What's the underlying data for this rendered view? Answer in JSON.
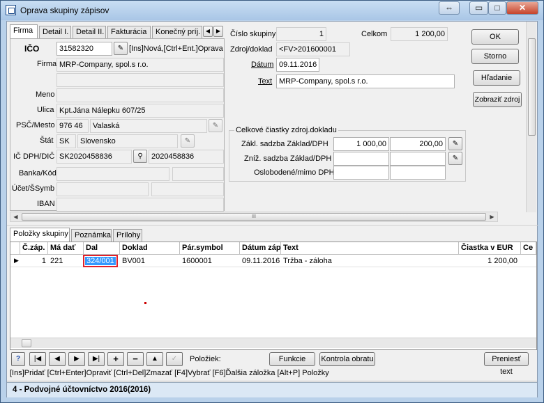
{
  "window": {
    "title": "Oprava skupiny zápisov",
    "controls": {
      "restore_glyph": "⇔",
      "minimize_glyph": "▭",
      "maximize_glyph": "□",
      "close_glyph": "✕"
    }
  },
  "top_tabs": [
    "Firma",
    "Detail I.",
    "Detail II.",
    "Fakturácia",
    "Konečný príj."
  ],
  "firm": {
    "ico_label": "IČO",
    "ico_value": "31582320",
    "ico_hint": "[Ins]Nová,[Ctrl+Ent.]Oprava",
    "firma_label": "Firma",
    "firma_value": "MRP-Company, spol.s r.o.",
    "meno_label": "Meno",
    "ulica_label": "Ulica",
    "ulica_value": "Kpt.Jána Nálepku 607/25",
    "psc_label": "PSČ/Mesto",
    "psc_value": "976 46",
    "mesto_value": "Valaská",
    "stat_label": "Štát",
    "stat_code": "SK",
    "stat_name": "Slovensko",
    "icdph_label": "IČ DPH/DIČ",
    "icdph_value": "SK2020458836",
    "dic_value": "2020458836",
    "banka_label": "Banka/Kód",
    "ucet_label": "Účet/ŠSymb",
    "iban_label": "IBAN"
  },
  "header": {
    "cislo_label": "Číslo skupiny",
    "cislo_value": "1",
    "celkom_label": "Celkom",
    "celkom_value": "1 200,00",
    "zdroj_label": "Zdroj/doklad",
    "zdroj_value": "<FV>201600001",
    "datum_label": "Dátum",
    "datum_value": "09.11.2016",
    "text_label": "Text",
    "text_value": "MRP-Company, spol.s r.o."
  },
  "totals": {
    "group_title": "Celkové čiastky zdroj.dokladu",
    "row1_label": "Zákl. sadzba Základ/DPH",
    "row1_base": "1 000,00",
    "row1_vat": "200,00",
    "row2_label": "Zníž. sadzba Základ/DPH",
    "row3_label": "Oslobodené/mimo DPH"
  },
  "buttons": {
    "ok": "OK",
    "storno": "Storno",
    "hladanie": "Hľadanie",
    "zobrazit": "Zobraziť zdroj",
    "funkcie": "Funkcie",
    "kontrola": "Kontrola obratu",
    "preniest": "Preniesť text"
  },
  "bottom_tabs": [
    "Položky skupiny",
    "Poznámka",
    "Prílohy"
  ],
  "grid": {
    "columns": [
      "Č.záp.",
      "Má dať",
      "Dal",
      "Doklad",
      "Pár.symbol",
      "Dátum záp",
      "Text",
      "Čiastka v EUR",
      "Ce"
    ],
    "rows": [
      {
        "cislo": "1",
        "ma_dat": "221",
        "dal": "324/001",
        "doklad": "BV001",
        "par_symbol": "1600001",
        "datum": "09.11.2016",
        "text": "Tržba - záloha",
        "ciastka": "1 200,00"
      }
    ]
  },
  "nav": {
    "help": "?",
    "first": "|◀",
    "prev": "◀",
    "next": "▶",
    "last": "▶|",
    "add": "+",
    "remove": "−",
    "up": "▲",
    "check": "✓",
    "polozkiek_label": "Položiek:"
  },
  "status_hint": "[Ins]Pridať [Ctrl+Enter]Opraviť [Ctrl+Del]Zmazať [F4]Vybrať [F6]Ďalšia záložka [Alt+P] Položky",
  "status_bar": "4 - Podvojné účtovníctvo 2016(2016)",
  "scroll": {
    "hscroll_grip": "III"
  },
  "colors": {
    "selection": "#3399ff",
    "highlight_border": "#e0202a",
    "title_bg": "#b9d1ea",
    "status_bar_bg": "#dbe8f5"
  }
}
